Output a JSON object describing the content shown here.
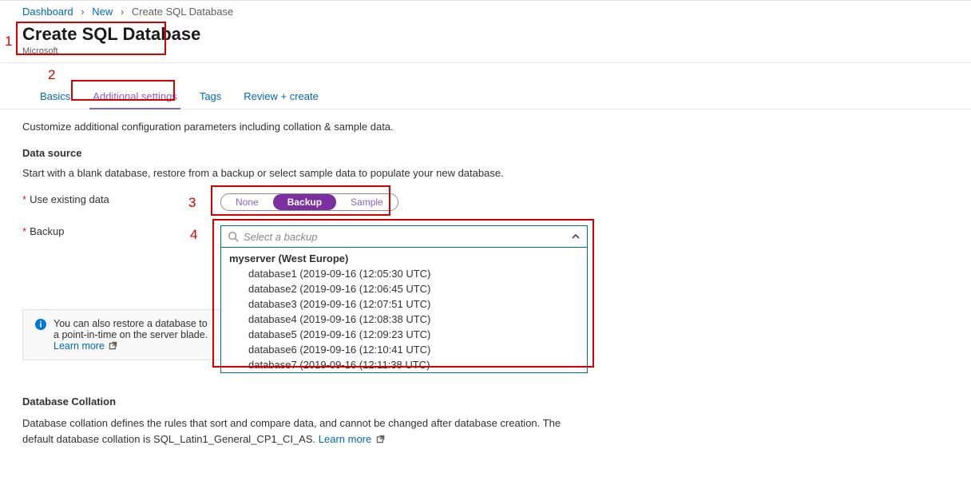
{
  "breadcrumb": {
    "items": [
      "Dashboard",
      "New",
      "Create SQL Database"
    ]
  },
  "header": {
    "title": "Create SQL Database",
    "subtitle": "Microsoft"
  },
  "tabs": [
    {
      "label": "Basics",
      "active": false
    },
    {
      "label": "Additional settings",
      "active": true
    },
    {
      "label": "Tags",
      "active": false
    },
    {
      "label": "Review + create",
      "active": false
    }
  ],
  "intro_text": "Customize additional configuration parameters including collation & sample data.",
  "data_source": {
    "heading": "Data source",
    "desc": "Start with a blank database, restore from a backup or select sample data to populate your new database.",
    "use_existing_label": "Use existing data",
    "options": [
      {
        "label": "None",
        "selected": false
      },
      {
        "label": "Backup",
        "selected": true
      },
      {
        "label": "Sample",
        "selected": false
      }
    ],
    "backup_label": "Backup",
    "backup_dropdown": {
      "placeholder": "Select a backup",
      "group_label": "myserver (West Europe)",
      "items": [
        "database1 (2019-09-16 (12:05:30 UTC)",
        "database2 (2019-09-16 (12:06:45 UTC)",
        "database3 (2019-09-16 (12:07:51 UTC)",
        "database4 (2019-09-16 (12:08:38 UTC)",
        "database5 (2019-09-16 (12:09:23 UTC)",
        "database6 (2019-09-16 (12:10:41 UTC)",
        "database7 (2019-09-16 (12:11:38 UTC)"
      ]
    }
  },
  "info_box": {
    "text_prefix": "You can also restore a database to a ",
    "text_mid": "server blade. ",
    "learn_more": "Learn more"
  },
  "collation": {
    "heading": "Database Collation",
    "desc_prefix": "Database collation defines the rules that sort and compare data, and cannot be changed after database creation. The default database collation is SQL_Latin1_General_CP1_CI_AS. ",
    "learn_more": "Learn more"
  },
  "annotations": {
    "n1": "1",
    "n2": "2",
    "n3": "3",
    "n4": "4"
  }
}
